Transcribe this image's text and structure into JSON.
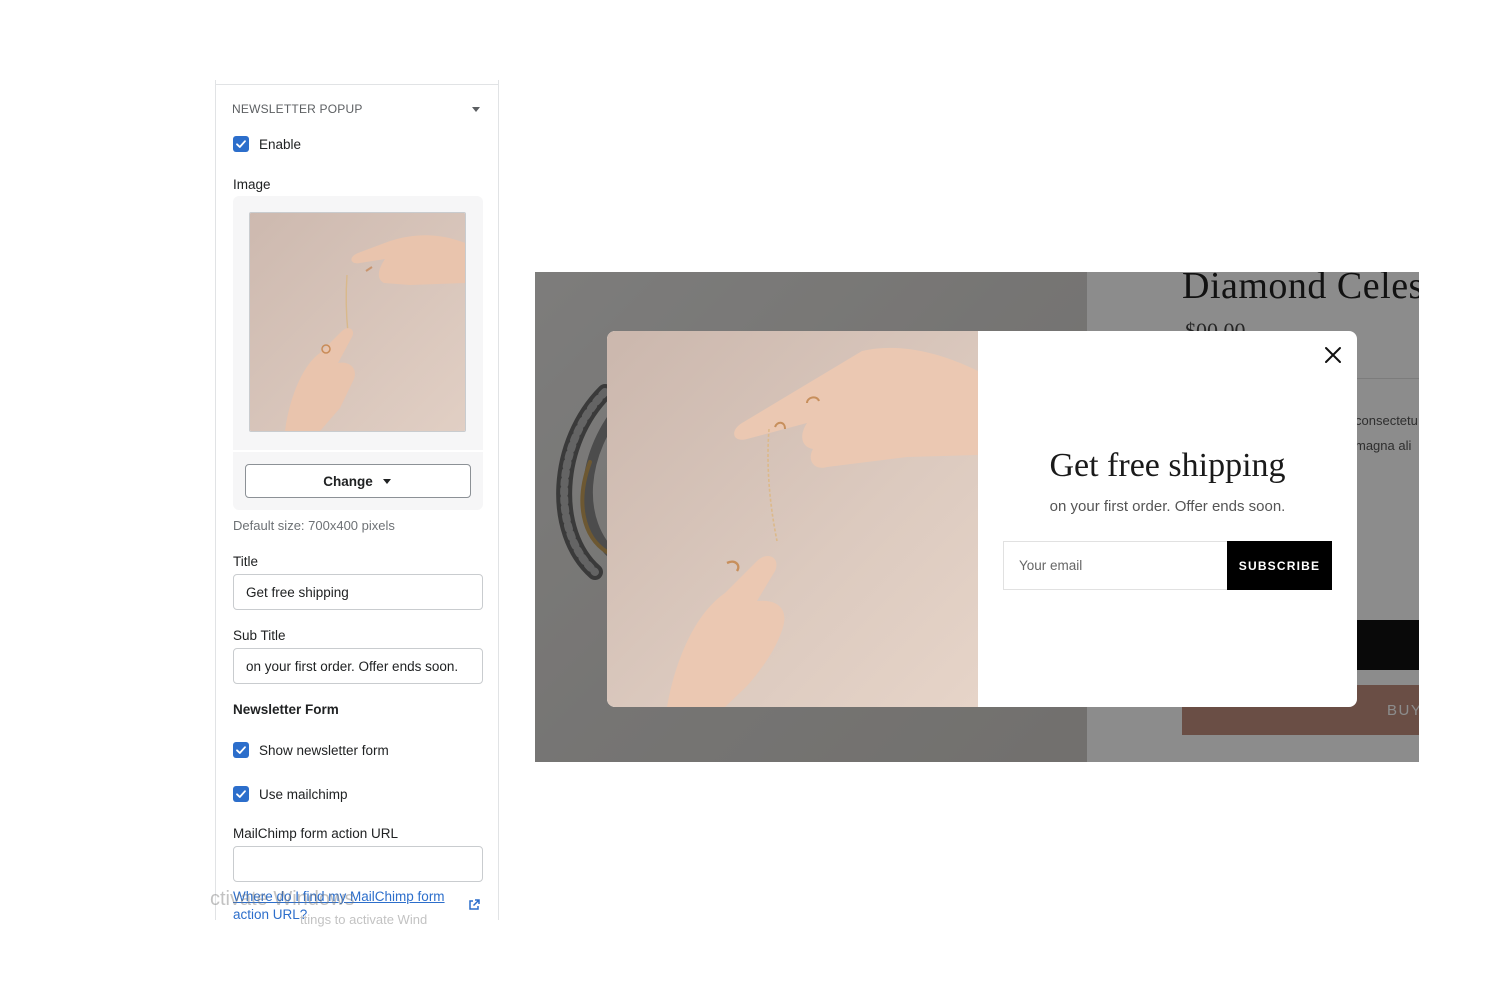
{
  "panel": {
    "section_title": "NEWSLETTER POPUP",
    "enable": {
      "label": "Enable",
      "checked": true
    },
    "image": {
      "label": "Image",
      "change_label": "Change",
      "default_size": "Default size: 700x400 pixels"
    },
    "title_field": {
      "label": "Title",
      "value": "Get free shipping"
    },
    "subtitle_field": {
      "label": "Sub Title",
      "value": "on your first order. Offer ends soon."
    },
    "newsletter_form": {
      "heading": "Newsletter Form",
      "show_form": {
        "label": "Show newsletter form",
        "checked": true
      },
      "use_mailchimp": {
        "label": "Use mailchimp",
        "checked": true
      }
    },
    "mailchimp_url": {
      "label": "MailChimp form action URL",
      "value": ""
    },
    "help_link": "Where do I find my MailChimp form action URL?"
  },
  "watermark": {
    "line1": "ctivate Windows",
    "line2": "ttings to activate Wind"
  },
  "preview": {
    "product_title": "Diamond Celes",
    "product_price": "$00.00",
    "desc_line1": "consectetu",
    "desc_line2": "magna ali",
    "buy_label": "BUY",
    "popup": {
      "title": "Get free shipping",
      "subtitle": "on your first order. Offer ends soon.",
      "email_placeholder": "Your email",
      "subscribe_label": "SUBSCRIBE"
    }
  },
  "colors": {
    "checkbox": "#2c6ecb",
    "link": "#2c6ecb",
    "subscribe_bg": "#000000",
    "buy_bg": "#c18f7e"
  }
}
